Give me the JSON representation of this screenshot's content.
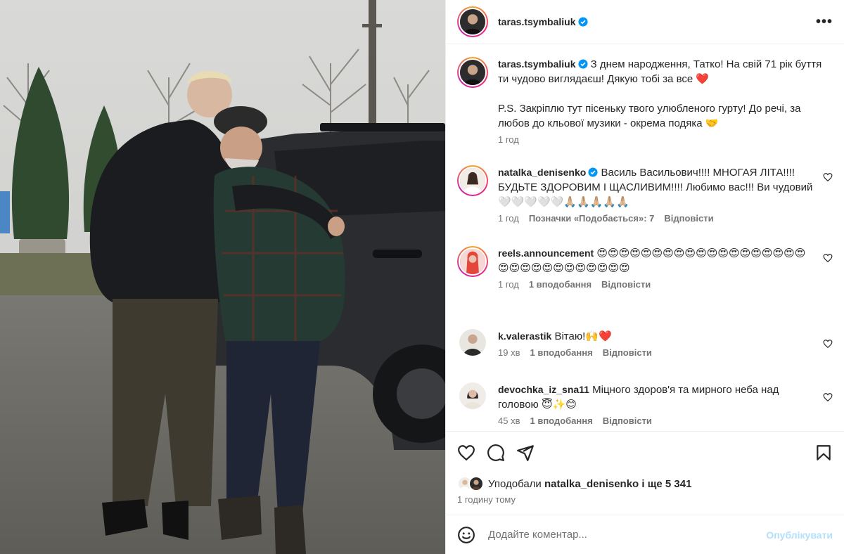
{
  "post": {
    "author": "taras.tsymbaliuk",
    "caption": "З днем народження, Татко! На свій 71 рік буття ти чудово виглядаєш! Дякую тобі за все ❤️",
    "caption_ps": "P.S. Закріплю тут пісеньку твого улюбленого гурту! До речі, за любов до кльової музики - окрема подяка 🤝",
    "caption_time": "1 год",
    "more_label": "•••"
  },
  "comments": [
    {
      "user": "natalka_denisenko",
      "text": "Василь Васильович!!!! МНОГАЯ ЛІТА!!!! БУДЬТЕ ЗДОРОВИМ І ЩАСЛИВИМ!!!! Любимо вас!!! Ви чудовий 🤍🤍🤍🤍🤍🙏🏼🙏🏼🙏🏼🙏🏼🙏🏼",
      "time": "1 год",
      "likes": "Позначки «Подобається»: 7",
      "reply": "Відповісти"
    },
    {
      "user": "reels.announcement",
      "text": "😍😍😍😍😍😍😍😍😍😍😍😍😍😍😍😍😍😍😍😍😍😍😍😍😍😍😍😍😍😍😍",
      "time": "1 год",
      "likes": "1 вподобання",
      "reply": "Відповісти"
    },
    {
      "user": "k.valerastik",
      "text": "Вітаю!🙌❤️",
      "time": "19 хв",
      "likes": "1 вподобання",
      "reply": "Відповісти"
    },
    {
      "user": "devochka_iz_sna11",
      "text": "Міцного здоров'я та мирного неба над головою 😇✨😊",
      "time": "45 хв",
      "likes": "1 вподобання",
      "reply": "Відповісти"
    }
  ],
  "likes_bar": {
    "prefix": "Уподобали",
    "user": "natalka_denisenko",
    "rest": "і ще 5 341"
  },
  "post_time": "1 годину тому",
  "compose": {
    "placeholder": "Додайте коментар...",
    "publish": "Опублікувати"
  },
  "colors": {
    "verified": "#0095f6",
    "heart": "#ed4956",
    "publish_disabled": "#b2dffc",
    "secondary_text": "#737373"
  },
  "icons": [
    "more-icon",
    "verified-icon",
    "heart-icon",
    "comment-icon",
    "share-icon",
    "bookmark-icon",
    "emoji-icon"
  ]
}
